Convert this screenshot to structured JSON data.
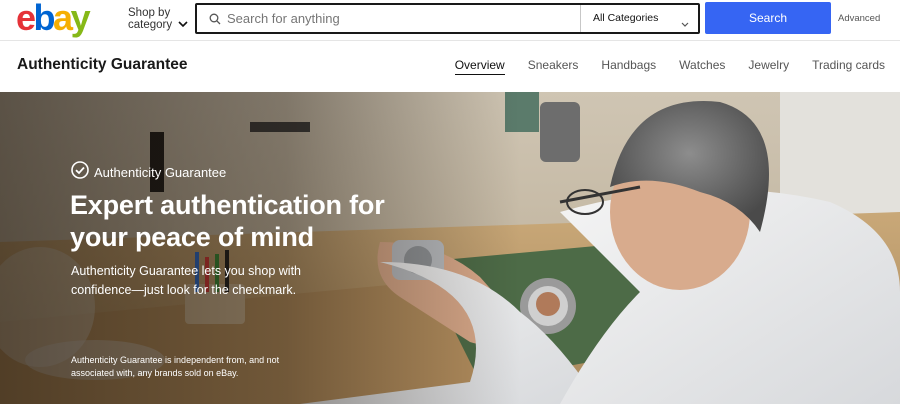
{
  "header": {
    "logo_letters": [
      {
        "char": "e",
        "color": "#e53238"
      },
      {
        "char": "b",
        "color": "#0064d2"
      },
      {
        "char": "a",
        "color": "#f5af02"
      },
      {
        "char": "y",
        "color": "#86b817"
      }
    ],
    "shop_by_label": "Shop by category",
    "search": {
      "placeholder": "Search for anything",
      "value": "",
      "category_selected": "All Categories",
      "button_label": "Search"
    },
    "advanced_label": "Advanced",
    "accent_color": "#3665f3"
  },
  "subnav": {
    "title": "Authenticity Guarantee",
    "tabs": [
      {
        "label": "Overview",
        "active": true
      },
      {
        "label": "Sneakers",
        "active": false
      },
      {
        "label": "Handbags",
        "active": false
      },
      {
        "label": "Watches",
        "active": false
      },
      {
        "label": "Jewelry",
        "active": false
      },
      {
        "label": "Trading cards",
        "active": false
      }
    ]
  },
  "hero": {
    "badge_label": "Authenticity Guarantee",
    "badge_icon": "check-circle-icon",
    "headline": "Expert authentication for your peace of mind",
    "subhead": "Authenticity Guarantee lets you shop with confidence—just look for the checkmark.",
    "disclaimer": "Authenticity Guarantee is independent from, and not associated with, any brands sold on eBay."
  }
}
